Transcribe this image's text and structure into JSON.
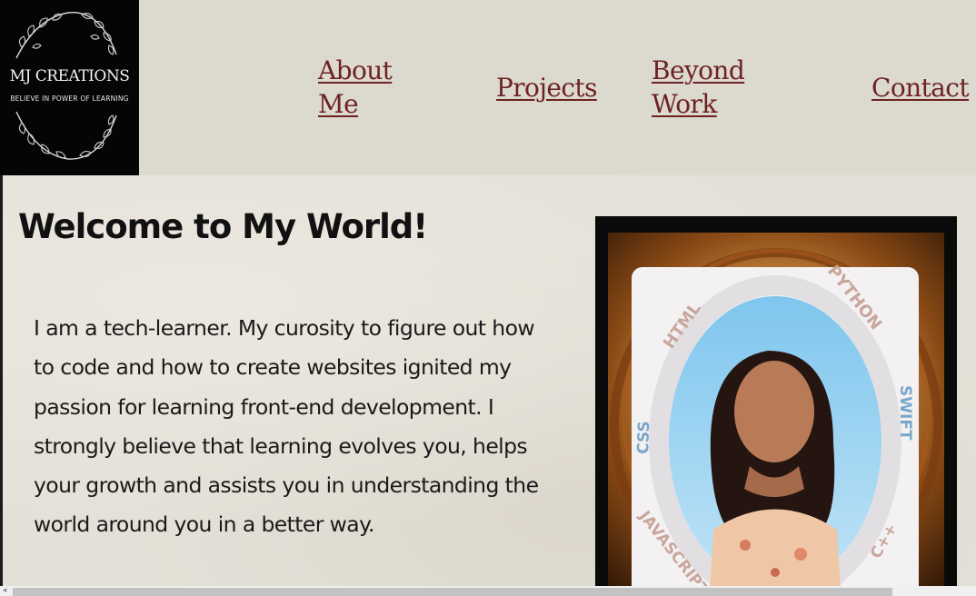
{
  "logo": {
    "title": "MJ CREATIONS",
    "tagline": "BELIEVE IN POWER OF LEARNING"
  },
  "nav": {
    "about_line1": "About",
    "about_line2": "Me",
    "projects": "Projects",
    "beyond_line1": "Beyond",
    "beyond_line2": "Work",
    "contact": "Contact"
  },
  "main": {
    "headline": "Welcome to My World!",
    "bio": "I am a tech-learner. My curosity to figure out how to code and how to create websites ignited my passion for learning front-end development. I strongly believe that learning evolves you, helps your growth and assists you in understanding the world around you in a better way."
  },
  "profile_ring": {
    "labels": [
      "HTML",
      "PYTHON",
      "CSS",
      "SWIFT",
      "JAVASCRIPT",
      "C++"
    ]
  },
  "colors": {
    "header_bg": "#dcd9cf",
    "nav_link": "#6e2222",
    "logo_bg": "#050505"
  }
}
